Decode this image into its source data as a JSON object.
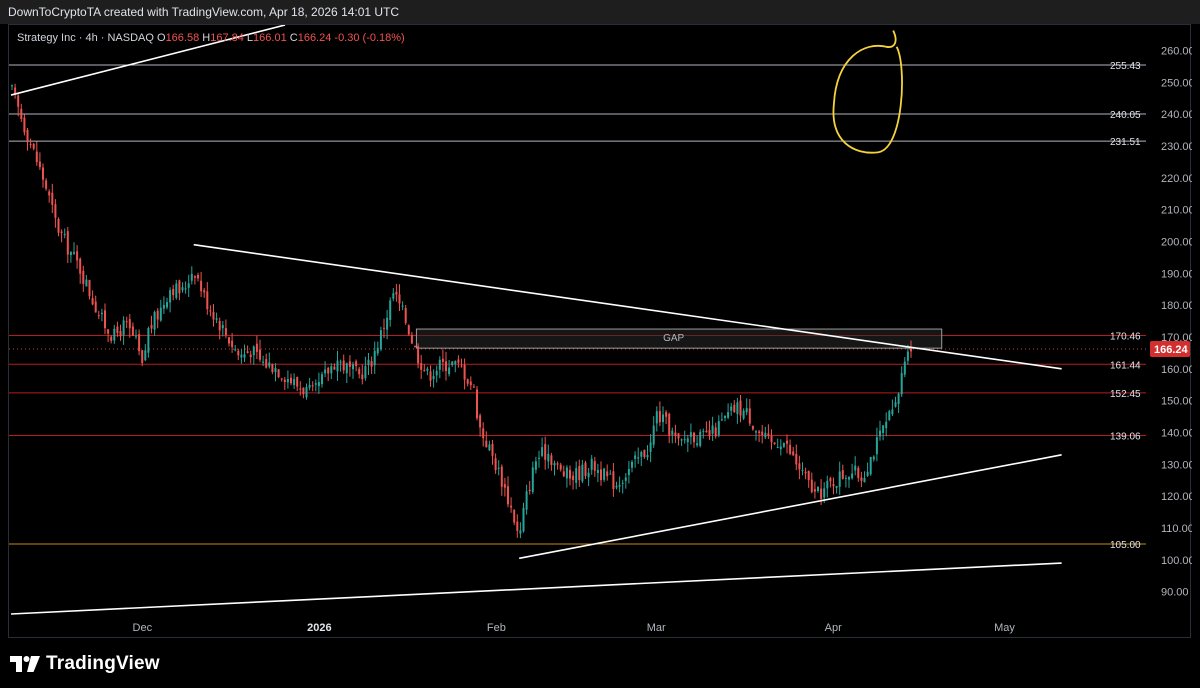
{
  "header": {
    "caption": "DownToCryptoTA created with TradingView.com, Apr 18, 2026 14:01 UTC"
  },
  "footer": {
    "brand": "TradingView"
  },
  "colors": {
    "up": "#26a69a",
    "down": "#ef5350",
    "level_line": "#b71c1c",
    "support_line": "#c88a12",
    "trend_line": "#ffffff",
    "gray_line": "#b2b5be",
    "highlight_circle": "#f5d33a",
    "price_badge": "#d32f2f"
  },
  "chart_data": {
    "type": "candlestick",
    "legend": {
      "symbol": "Strategy Inc · 4h · NASDAQ",
      "o_label": "O",
      "o_value": "166.58",
      "h_label": "H",
      "h_value": "167.84",
      "l_label": "L",
      "l_value": "166.01",
      "c_label": "C",
      "c_value": "166.24",
      "change": "-0.30 (-0.18%)"
    },
    "y_axis": {
      "min": 83,
      "max": 268,
      "ticks": [
        90,
        100,
        110,
        120,
        130,
        140,
        150,
        160,
        170,
        180,
        190,
        200,
        210,
        220,
        230,
        240,
        250,
        260
      ]
    },
    "x_axis": {
      "labels": [
        {
          "text": "Dec",
          "date": "2025-12-01"
        },
        {
          "text": "2026",
          "date": "2026-01-01"
        },
        {
          "text": "Feb",
          "date": "2026-02-01"
        },
        {
          "text": "Mar",
          "date": "2026-03-01"
        },
        {
          "text": "Apr",
          "date": "2026-04-01"
        },
        {
          "text": "May",
          "date": "2026-05-01"
        }
      ]
    },
    "current_price": "166.24",
    "horizontal_levels": [
      {
        "value": 255.43,
        "label": "255.43",
        "style": "gray"
      },
      {
        "value": 240.05,
        "label": "240.05",
        "style": "gray"
      },
      {
        "value": 231.51,
        "label": "231.51",
        "style": "gray"
      },
      {
        "value": 170.46,
        "label": "170.46",
        "style": "red"
      },
      {
        "value": 161.44,
        "label": "161.44",
        "style": "red"
      },
      {
        "value": 152.45,
        "label": "152.45",
        "style": "red"
      },
      {
        "value": 139.06,
        "label": "139.06",
        "style": "red"
      },
      {
        "value": 105.0,
        "label": "105.00",
        "style": "orange"
      }
    ],
    "trend_lines": [
      {
        "start": [
          "2025-11-08",
          246
        ],
        "end": [
          "2025-12-26",
          268
        ]
      },
      {
        "start": [
          "2025-12-10",
          199
        ],
        "end": [
          "2026-05-11",
          160
        ]
      },
      {
        "start": [
          "2026-02-05",
          100.5
        ],
        "end": [
          "2026-05-11",
          133
        ]
      },
      {
        "start": [
          "2025-11-08",
          83
        ],
        "end": [
          "2026-05-11",
          99
        ]
      }
    ],
    "gap_box": {
      "label": "GAP",
      "start": "2026-01-18",
      "end": "2026-04-20",
      "top": 172.5,
      "bottom": 166.5
    },
    "highlight_zone": {
      "start": "2026-04-01",
      "end": "2026-04-13",
      "low": 228,
      "high": 262
    },
    "path": [
      [
        "2025-11-08",
        248
      ],
      [
        "2025-11-10",
        238
      ],
      [
        "2025-11-12",
        228
      ],
      [
        "2025-11-14",
        218
      ],
      [
        "2025-11-16",
        205
      ],
      [
        "2025-11-18",
        198
      ],
      [
        "2025-11-20",
        192
      ],
      [
        "2025-11-22",
        183
      ],
      [
        "2025-11-24",
        175
      ],
      [
        "2025-11-26",
        170
      ],
      [
        "2025-11-28",
        174
      ],
      [
        "2025-11-30",
        168
      ],
      [
        "2025-12-01",
        160
      ],
      [
        "2025-12-02",
        172
      ],
      [
        "2025-12-04",
        178
      ],
      [
        "2025-12-06",
        186
      ],
      [
        "2025-12-08",
        184
      ],
      [
        "2025-12-10",
        192
      ],
      [
        "2025-12-12",
        182
      ],
      [
        "2025-12-14",
        176
      ],
      [
        "2025-12-16",
        170
      ],
      [
        "2025-12-18",
        164
      ],
      [
        "2025-12-20",
        166
      ],
      [
        "2025-12-22",
        162
      ],
      [
        "2025-12-24",
        161
      ],
      [
        "2025-12-26",
        158
      ],
      [
        "2025-12-28",
        155
      ],
      [
        "2025-12-31",
        152
      ],
      [
        "2026-01-02",
        158
      ],
      [
        "2026-01-04",
        163
      ],
      [
        "2026-01-06",
        160
      ],
      [
        "2026-01-08",
        158
      ],
      [
        "2026-01-10",
        162
      ],
      [
        "2026-01-12",
        172
      ],
      [
        "2026-01-14",
        184
      ],
      [
        "2026-01-16",
        176
      ],
      [
        "2026-01-18",
        165
      ],
      [
        "2026-01-20",
        158
      ],
      [
        "2026-01-22",
        161
      ],
      [
        "2026-01-24",
        162
      ],
      [
        "2026-01-26",
        160
      ],
      [
        "2026-01-28",
        154
      ],
      [
        "2026-01-29",
        142
      ],
      [
        "2026-01-31",
        134
      ],
      [
        "2026-02-02",
        125
      ],
      [
        "2026-02-04",
        114
      ],
      [
        "2026-02-05",
        106
      ],
      [
        "2026-02-06",
        118
      ],
      [
        "2026-02-08",
        132
      ],
      [
        "2026-02-10",
        134
      ],
      [
        "2026-02-12",
        128
      ],
      [
        "2026-02-14",
        126
      ],
      [
        "2026-02-16",
        128
      ],
      [
        "2026-02-18",
        130
      ],
      [
        "2026-02-20",
        126
      ],
      [
        "2026-02-22",
        124
      ],
      [
        "2026-02-24",
        128
      ],
      [
        "2026-02-26",
        132
      ],
      [
        "2026-02-28",
        136
      ],
      [
        "2026-03-01",
        146
      ],
      [
        "2026-03-03",
        142
      ],
      [
        "2026-03-05",
        136
      ],
      [
        "2026-03-07",
        140
      ],
      [
        "2026-03-09",
        138
      ],
      [
        "2026-03-11",
        140
      ],
      [
        "2026-03-13",
        144
      ],
      [
        "2026-03-15",
        148
      ],
      [
        "2026-03-17",
        146
      ],
      [
        "2026-03-19",
        140
      ],
      [
        "2026-03-21",
        136
      ],
      [
        "2026-03-23",
        138
      ],
      [
        "2026-03-25",
        132
      ],
      [
        "2026-03-27",
        126
      ],
      [
        "2026-03-29",
        120
      ],
      [
        "2026-03-31",
        123
      ],
      [
        "2026-04-02",
        126
      ],
      [
        "2026-04-04",
        128
      ],
      [
        "2026-04-06",
        126
      ],
      [
        "2026-04-08",
        134
      ],
      [
        "2026-04-10",
        142
      ],
      [
        "2026-04-12",
        148
      ],
      [
        "2026-04-13",
        158
      ],
      [
        "2026-04-14",
        168
      ],
      [
        "2026-04-15",
        166.24
      ]
    ]
  }
}
